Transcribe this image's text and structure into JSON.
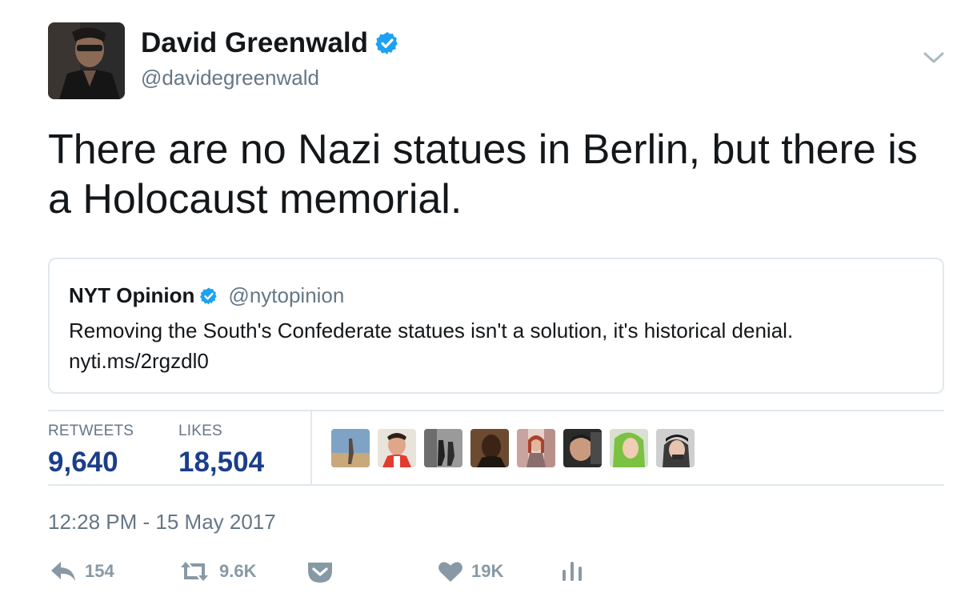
{
  "author": {
    "name": "David Greenwald",
    "handle": "@davidegreenwald",
    "verified": true
  },
  "tweet": {
    "text": "There are no Nazi statues in Berlin, but there is a Holocaust memorial."
  },
  "quoted_tweet": {
    "name": "NYT Opinion",
    "handle": "@nytopinion",
    "verified": true,
    "text": "Removing the South's Confederate statues isn't a solution, it's historical denial.",
    "link": "nyti.ms/2rgzdl0"
  },
  "stats": {
    "retweets_label": "RETWEETS",
    "retweets_value": "9,640",
    "likes_label": "LIKES",
    "likes_value": "18,504"
  },
  "timestamp": "12:28 PM - 15 May 2017",
  "actions": {
    "reply_count": "154",
    "retweet_count": "9.6K",
    "like_count": "19K"
  },
  "colors": {
    "verified": "#1da1f2",
    "stat_value": "#1b3e8a",
    "muted": "#657786",
    "icon": "#8899a6",
    "border": "#e1e8ed"
  },
  "icons": {
    "verified": "verified-badge-icon",
    "menu": "chevron-down-icon",
    "reply": "reply-icon",
    "retweet": "retweet-icon",
    "pocket": "pocket-icon",
    "like": "heart-icon",
    "analytics": "analytics-icon"
  }
}
